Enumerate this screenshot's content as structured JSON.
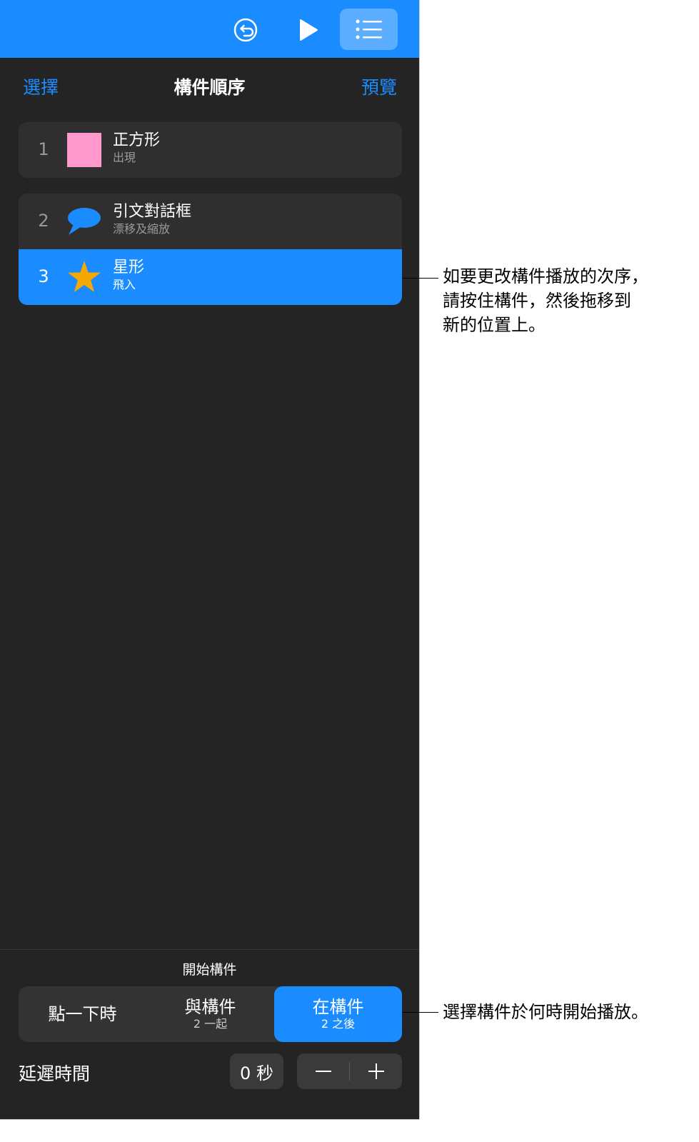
{
  "header": {
    "select_label": "選擇",
    "title": "構件順序",
    "preview_label": "預覽"
  },
  "builds": [
    {
      "number": "1",
      "name": "正方形",
      "effect": "出現",
      "thumb": "pink-square-icon",
      "selected": false
    },
    {
      "number": "2",
      "name": "引文對話框",
      "effect": "漂移及縮放",
      "thumb": "speech-bubble-icon",
      "selected": false
    },
    {
      "number": "3",
      "name": "星形",
      "effect": "飛入",
      "thumb": "star-icon",
      "selected": true
    }
  ],
  "start": {
    "label": "開始構件",
    "options": [
      {
        "main": "點一下時",
        "sub": ""
      },
      {
        "main": "與構件",
        "sub": "2 一起"
      },
      {
        "main": "在構件",
        "sub": "2 之後"
      }
    ],
    "selected_index": 2
  },
  "delay": {
    "label": "延遲時間",
    "value": "0 秒"
  },
  "callouts": {
    "reorder_lines": [
      "如要更改構件播放的次序，",
      "請按住構件，然後拖移到",
      "新的位置上。"
    ],
    "start_line": "選擇構件於何時開始播放。"
  },
  "colors": {
    "accent": "#1a8cff",
    "panel_bg": "#242424",
    "row_bg": "#2f2f2f",
    "square_fill": "#ff99cc",
    "bubble_fill": "#1a8cff",
    "star_fill": "#f5a800"
  }
}
